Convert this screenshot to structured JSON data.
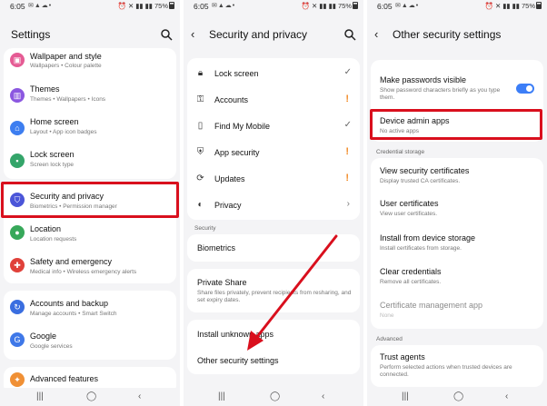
{
  "status": {
    "time": "6:05",
    "battery": "75%"
  },
  "settings": {
    "title": "Settings",
    "items": [
      {
        "label": "Wallpaper and style",
        "sub": "Wallpapers • Colour palette",
        "color": "#e55b94",
        "icon": "wallpaper-icon"
      },
      {
        "label": "Themes",
        "sub": "Themes • Wallpapers • Icons",
        "color": "#8b57e0",
        "icon": "themes-icon"
      },
      {
        "label": "Home screen",
        "sub": "Layout • App icon badges",
        "color": "#3d7ef0",
        "icon": "home-screen-icon"
      },
      {
        "label": "Lock screen",
        "sub": "Screen lock type",
        "color": "#34a56a",
        "icon": "lock-icon"
      },
      {
        "label": "Security and privacy",
        "sub": "Biometrics • Permission manager",
        "color": "#4b55d8",
        "icon": "shield-icon"
      },
      {
        "label": "Location",
        "sub": "Location requests",
        "color": "#37a85a",
        "icon": "location-pin-icon"
      },
      {
        "label": "Safety and emergency",
        "sub": "Medical info • Wireless emergency alerts",
        "color": "#e0413a",
        "icon": "safety-icon"
      },
      {
        "label": "Accounts and backup",
        "sub": "Manage accounts • Smart Switch",
        "color": "#3a6ee0",
        "icon": "sync-icon"
      },
      {
        "label": "Google",
        "sub": "Google services",
        "color": "#3f78e8",
        "icon": "google-icon"
      },
      {
        "label": "Advanced features",
        "sub": "",
        "color": "#f09035",
        "icon": "advanced-features-icon"
      }
    ]
  },
  "security": {
    "title": "Security and privacy",
    "items": [
      {
        "label": "Lock screen",
        "status": "✓"
      },
      {
        "label": "Accounts",
        "status": "!"
      },
      {
        "label": "Find My Mobile",
        "status": "✓"
      },
      {
        "label": "App security",
        "status": "!"
      },
      {
        "label": "Updates",
        "status": "!"
      },
      {
        "label": "Privacy",
        "status": "›"
      }
    ],
    "section_label": "Security",
    "biometrics": "Biometrics",
    "private_share": {
      "label": "Private Share",
      "sub": "Share files privately, prevent recipients from resharing, and set expiry dates."
    },
    "install_unknown": "Install unknown apps",
    "other_settings": "Other security settings"
  },
  "other": {
    "title": "Other security settings",
    "make_passwords": {
      "label": "Make passwords visible",
      "sub": "Show password characters briefly as you type them."
    },
    "device_admin": {
      "label": "Device admin apps",
      "sub": "No active apps"
    },
    "credential_section": "Credential storage",
    "credential_items": [
      {
        "label": "View security certificates",
        "sub": "Display trusted CA certificates."
      },
      {
        "label": "User certificates",
        "sub": "View user certificates."
      },
      {
        "label": "Install from device storage",
        "sub": "Install certificates from storage."
      },
      {
        "label": "Clear credentials",
        "sub": "Remove all certificates."
      },
      {
        "label": "Certificate management app",
        "sub": "None"
      }
    ],
    "advanced_section": "Advanced",
    "trust_agents": {
      "label": "Trust agents",
      "sub": "Perform selected actions when trusted devices are connected."
    }
  },
  "colors": {
    "highlight": "#d90f1d",
    "toggle": "#3c7ef7",
    "warning": "#f28c28"
  }
}
